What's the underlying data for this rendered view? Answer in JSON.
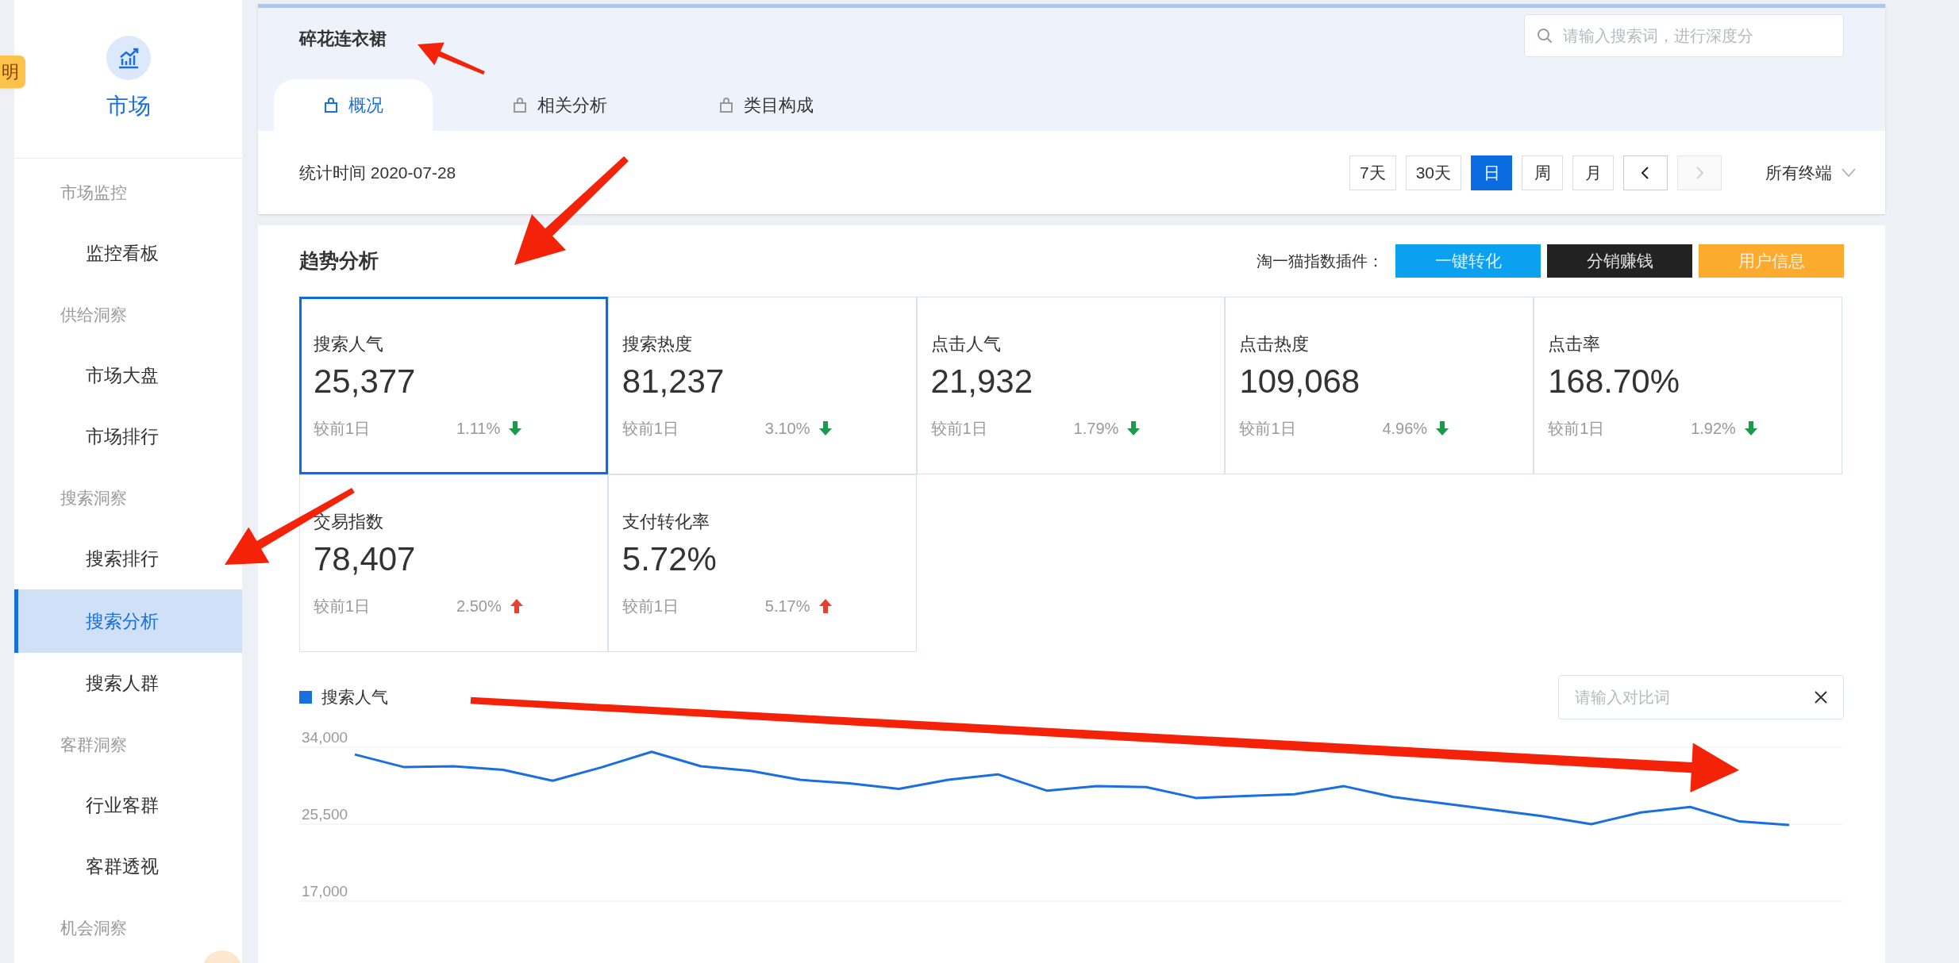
{
  "side_badge": {
    "label": "明"
  },
  "sidebar": {
    "title": "市场",
    "groups": [
      {
        "label": "市场监控",
        "items": [
          {
            "label": "监控看板",
            "selected": false
          }
        ]
      },
      {
        "label": "供给洞察",
        "items": [
          {
            "label": "市场大盘",
            "selected": false
          },
          {
            "label": "市场排行",
            "selected": false
          }
        ]
      },
      {
        "label": "搜索洞察",
        "items": [
          {
            "label": "搜索排行",
            "selected": false
          },
          {
            "label": "搜索分析",
            "selected": true
          },
          {
            "label": "搜索人群",
            "selected": false
          }
        ]
      },
      {
        "label": "客群洞察",
        "items": [
          {
            "label": "行业客群",
            "selected": false
          },
          {
            "label": "客群透视",
            "selected": false
          }
        ]
      },
      {
        "label": "机会洞察"
      }
    ]
  },
  "header": {
    "title": "碎花连衣裙",
    "search": {
      "placeholder": "请输入搜索词，进行深度分"
    }
  },
  "tabs": [
    {
      "label": "概况",
      "selected": true
    },
    {
      "label": "相关分析",
      "selected": false
    },
    {
      "label": "类目构成",
      "selected": false
    }
  ],
  "stat_bar": {
    "label": "统计时间 2020-07-28",
    "periods": [
      {
        "label": "7天",
        "selected": false
      },
      {
        "label": "30天",
        "selected": false
      },
      {
        "label": "日",
        "selected": true
      },
      {
        "label": "周",
        "selected": false
      },
      {
        "label": "月",
        "selected": false
      }
    ],
    "nav": [
      {
        "kind": "prev",
        "disabled": false
      },
      {
        "kind": "next",
        "disabled": true
      }
    ],
    "terminal": "所有终端"
  },
  "trend": {
    "title": "趋势分析",
    "plugin_label": "淘一猫指数插件：",
    "plugin_buttons": [
      {
        "label": "一键转化",
        "color": "#0ba0f0"
      },
      {
        "label": "分销赚钱",
        "color": "#222222"
      },
      {
        "label": "用户信息",
        "color": "#fcab2e"
      }
    ],
    "metrics": [
      {
        "label": "搜索人气",
        "value": "25,377",
        "compare": "较前1日",
        "change": "1.11%",
        "increase": false,
        "selected": true
      },
      {
        "label": "搜索热度",
        "value": "81,237",
        "compare": "较前1日",
        "change": "3.10%",
        "increase": false,
        "selected": false
      },
      {
        "label": "点击人气",
        "value": "21,932",
        "compare": "较前1日",
        "change": "1.79%",
        "increase": false,
        "selected": false
      },
      {
        "label": "点击热度",
        "value": "109,068",
        "compare": "较前1日",
        "change": "4.96%",
        "increase": false,
        "selected": false
      },
      {
        "label": "点击率",
        "value": "168.70%",
        "compare": "较前1日",
        "change": "1.92%",
        "increase": false,
        "selected": false
      },
      {
        "label": "交易指数",
        "value": "78,407",
        "compare": "较前1日",
        "change": "2.50%",
        "increase": true,
        "selected": false
      },
      {
        "label": "支付转化率",
        "value": "5.72%",
        "compare": "较前1日",
        "change": "5.17%",
        "increase": true,
        "selected": false
      }
    ],
    "compare_field": {
      "placeholder": "请输入对比词"
    },
    "chart_data": {
      "type": "line",
      "ylim": [
        17000,
        34000
      ],
      "yticks": [
        {
          "value": 17000,
          "label": "17,000"
        },
        {
          "value": 25500,
          "label": "25,500"
        },
        {
          "value": 34000,
          "label": "34,000"
        }
      ],
      "series": [
        {
          "name": "搜索人气",
          "color": "#1a6fdf",
          "values": [
            33200,
            31800,
            31900,
            31500,
            30300,
            31800,
            33500,
            31900,
            31400,
            30400,
            30000,
            29400,
            30400,
            31000,
            29200,
            29700,
            29600,
            28400,
            28600,
            28800,
            29700,
            28500,
            27800,
            27100,
            26400,
            25500,
            26800,
            27400,
            25800,
            25400
          ]
        }
      ]
    }
  }
}
